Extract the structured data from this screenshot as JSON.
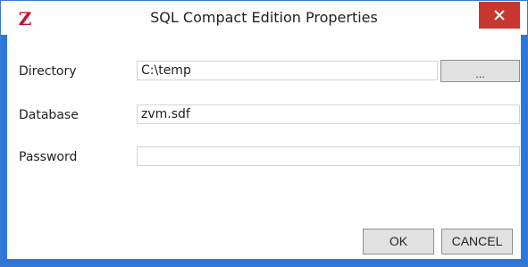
{
  "window": {
    "title": "SQL Compact Edition Properties",
    "app_icon_glyph": "Z",
    "close_icon": "close-x-icon"
  },
  "form": {
    "directory": {
      "label": "Directory",
      "value": "C:\\temp"
    },
    "database": {
      "label": "Database",
      "value": "zvm.sdf"
    },
    "password": {
      "label": "Password",
      "value": ""
    },
    "browse_label": "..."
  },
  "buttons": {
    "ok_label": "OK",
    "cancel_label": "CANCEL"
  },
  "colors": {
    "frame": "#2d77da",
    "close_button": "#c7372f",
    "app_icon": "#c8102e"
  }
}
